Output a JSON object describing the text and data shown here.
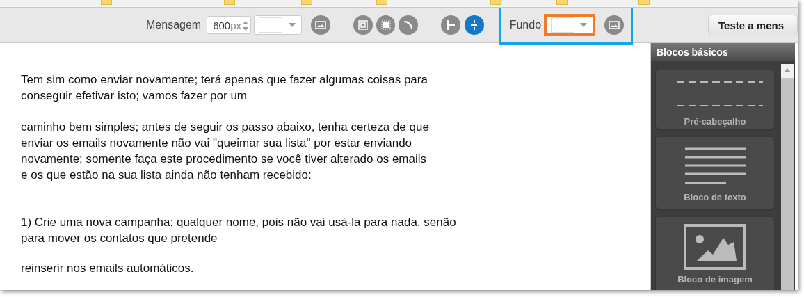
{
  "toolbar": {
    "message_label": "Mensagem",
    "width_value": "600",
    "width_unit": "px",
    "align_buttons": [
      {
        "selected": false
      },
      {
        "selected": true
      }
    ],
    "background_label": "Fundo",
    "test_button": "Teste a mens"
  },
  "content": {
    "paragraphs": [
      "Tem sim como enviar novamente; terá apenas que fazer algumas coisas para\nconseguir efetivar isto; vamos fazer por um",
      "caminho bem simples; antes de seguir os passo abaixo, tenha certeza de que\nenviar os emails novamente não vai \"queimar sua lista\" por estar enviando\nnovamente; somente faça este procedimento se você tiver alterado os emails\ne os que estão na sua lista ainda não tenham recebido:",
      "1) Crie uma nova campanha; qualquer nome, pois não vai usá-la para nada, senão\npara mover os contatos que pretende",
      "reinserir nos emails automáticos."
    ]
  },
  "sidebar": {
    "title": "Blocos básicos",
    "blocks": [
      {
        "kind": "preheader",
        "label": "Pré-cabeçalho"
      },
      {
        "kind": "text",
        "label": "Bloco de texto"
      },
      {
        "kind": "image",
        "label": "Bloco de imagem"
      }
    ]
  }
}
